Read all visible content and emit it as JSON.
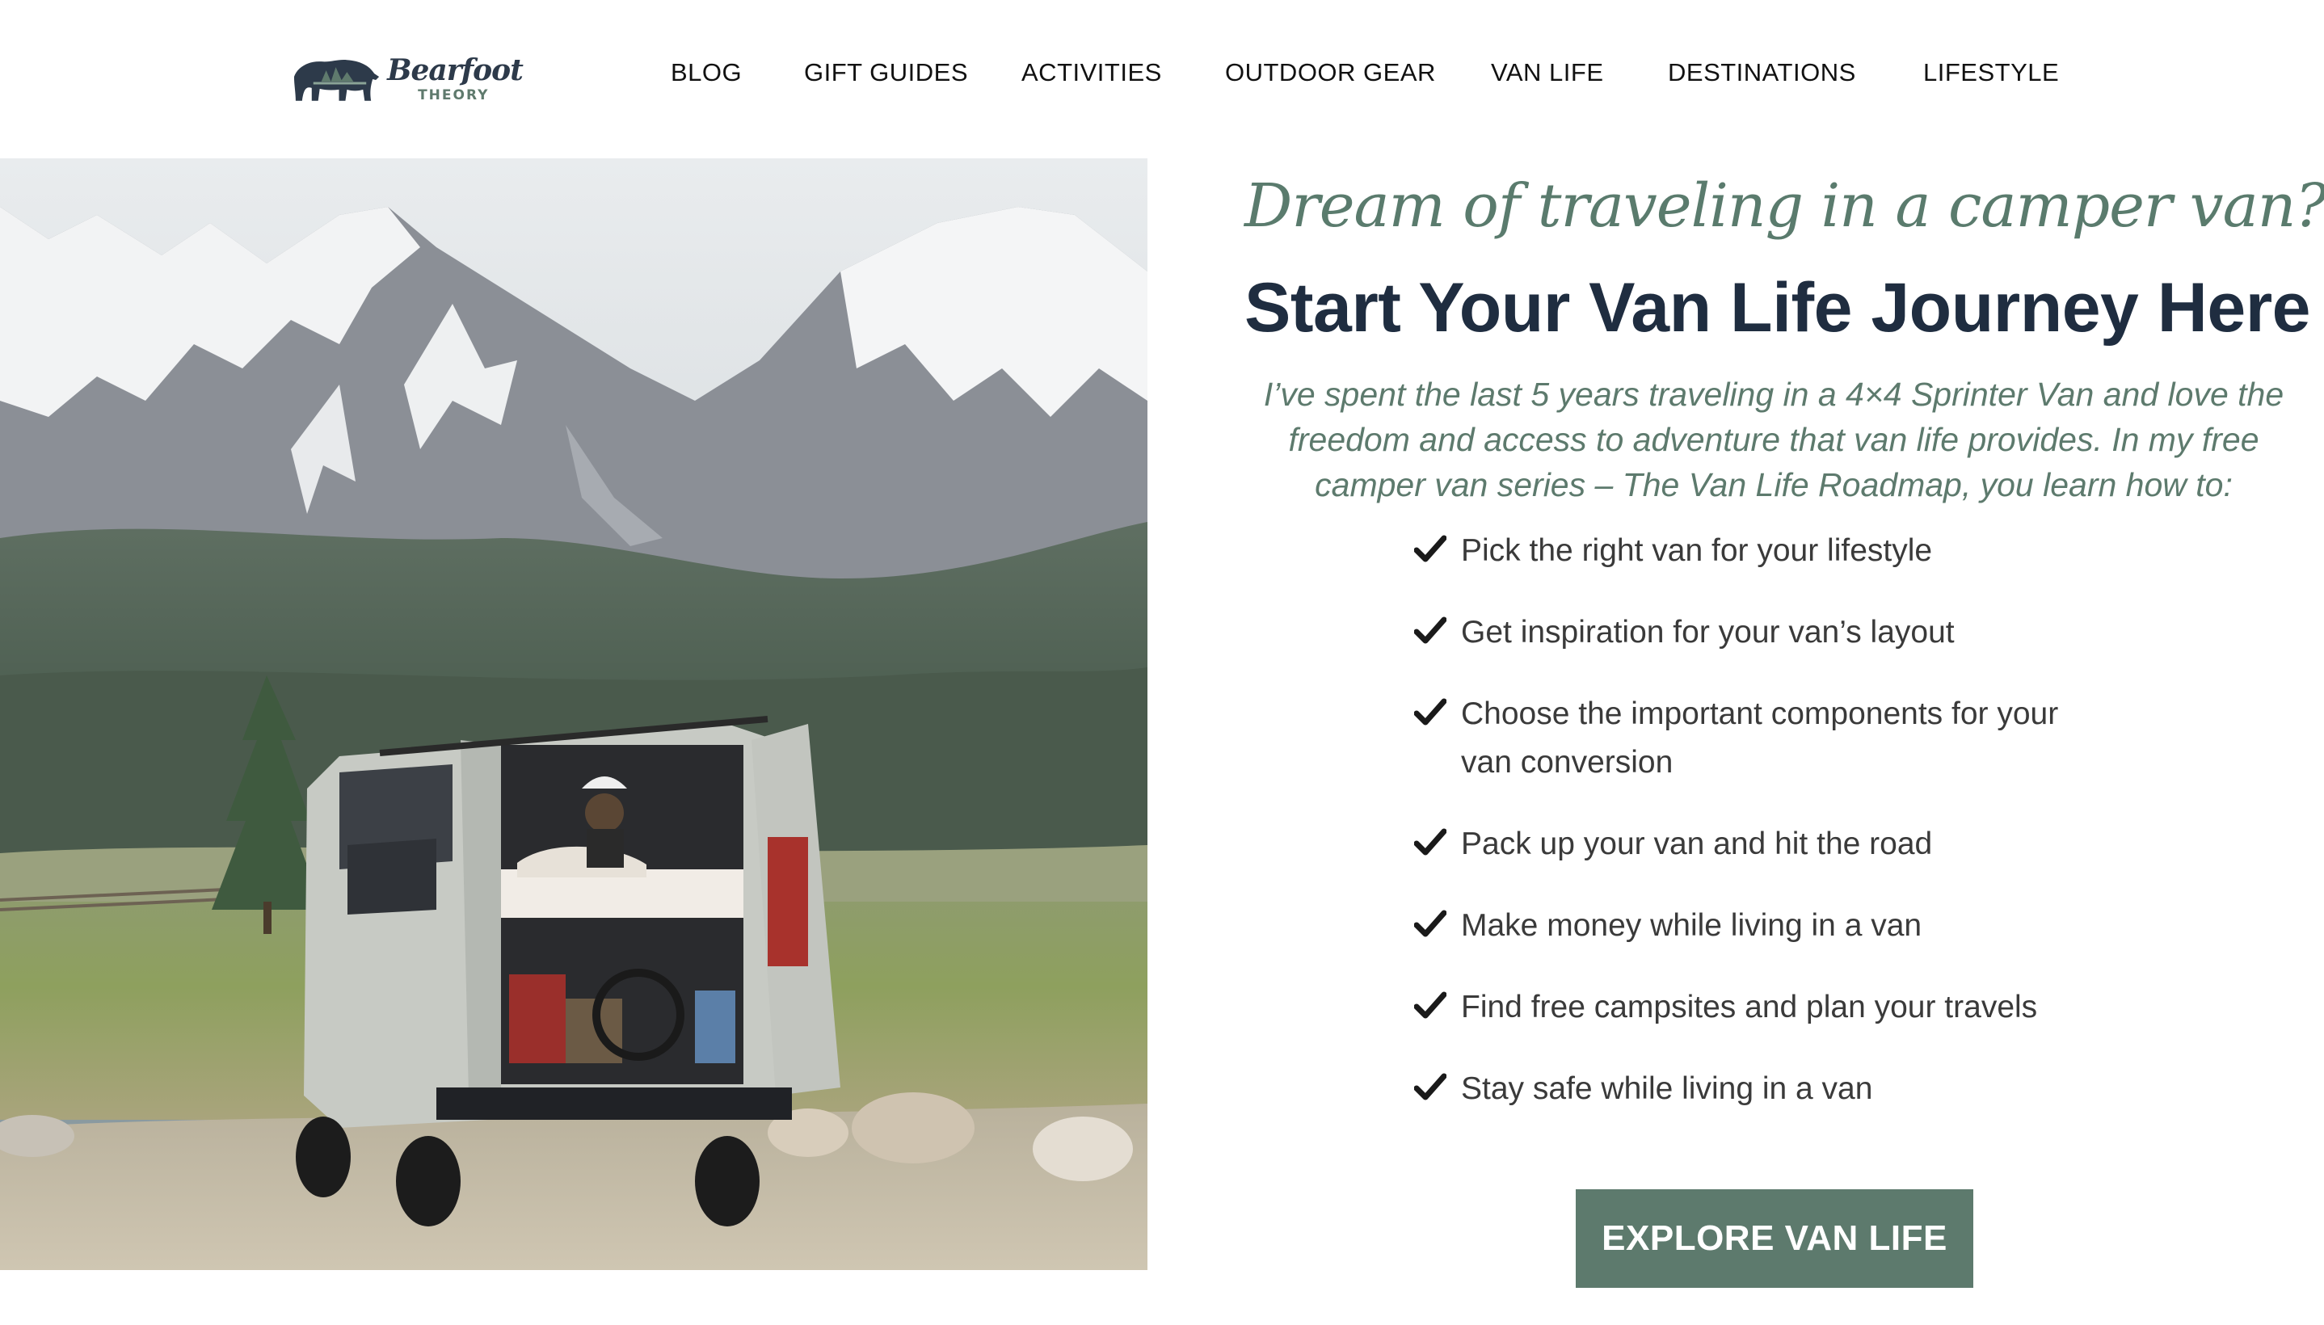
{
  "site": {
    "logo_word": "Bearfoot",
    "logo_sub": "THEORY",
    "logo_icon": "bear-silhouette-icon"
  },
  "nav": {
    "items": [
      {
        "label": "BLOG"
      },
      {
        "label": "GIFT GUIDES"
      },
      {
        "label": "ACTIVITIES"
      },
      {
        "label": "OUTDOOR GEAR"
      },
      {
        "label": "VAN LIFE"
      },
      {
        "label": "DESTINATIONS"
      },
      {
        "label": "LIFESTYLE"
      }
    ]
  },
  "hero": {
    "script_heading": "Dream of traveling in a camper van?",
    "heading": "Start Your Van Life Journey Here",
    "intro": "I’ve spent the last 5 years traveling in a 4×4 Sprinter Van and love the freedom and access to adventure that van life provides. In my free camper van series – The Van Life Roadmap, you learn how to:",
    "checklist": [
      {
        "icon": "checkmark-icon",
        "text": "Pick the right van for your lifestyle"
      },
      {
        "icon": "checkmark-icon",
        "text": "Get inspiration for your van’s layout"
      },
      {
        "icon": "checkmark-icon",
        "text": "Choose the important components for your van conversion"
      },
      {
        "icon": "checkmark-icon",
        "text": "Pack up your van and hit the road"
      },
      {
        "icon": "checkmark-icon",
        "text": "Make money while living in a van"
      },
      {
        "icon": "checkmark-icon",
        "text": "Find free campsites and plan your travels"
      },
      {
        "icon": "checkmark-icon",
        "text": "Stay safe while living in a van"
      }
    ],
    "cta_label": "EXPLORE VAN LIFE"
  },
  "colors": {
    "accent_green": "#5d7a6d",
    "heading_navy": "#1f2d40",
    "body_text": "#3a3a3a"
  }
}
